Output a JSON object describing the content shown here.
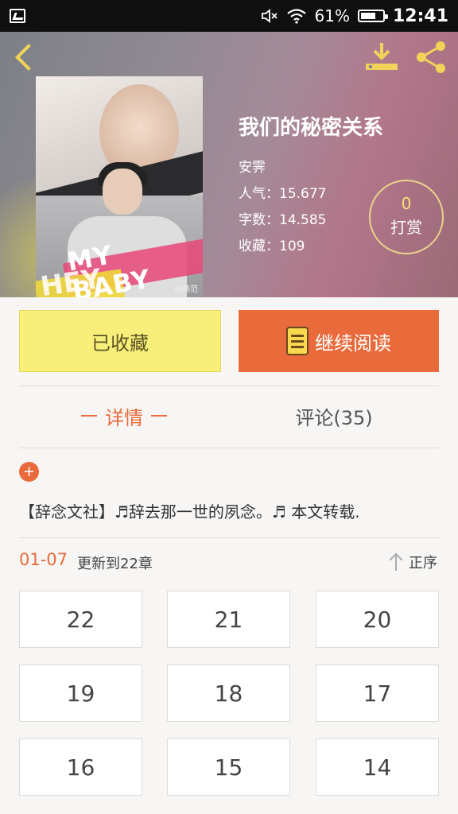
{
  "status_bar": {
    "battery": "61%",
    "time": "12:41",
    "icons": [
      "image-icon",
      "mute-icon",
      "wifi-icon",
      "battery-icon"
    ]
  },
  "book": {
    "title": "我们的秘密关系",
    "author": "安霁",
    "popularity": "人气：15.677",
    "word_count": "字数：14.585",
    "favorites": "收藏：109",
    "cover_text": {
      "line1": "MY BABY",
      "line2": "HEY",
      "watermark": "@韩范"
    }
  },
  "reward": {
    "count": "0",
    "label": "打赏"
  },
  "actions": {
    "favorited_label": "已收藏",
    "continue_label": "继续阅读"
  },
  "tabs": {
    "detail": "详情",
    "comments": "评论(35)"
  },
  "expand_icon": "+",
  "description": "【辞念文社】♬辞去那一世的夙念。♬    本文转载.",
  "update": {
    "date": "01-07",
    "text": "更新到22章",
    "sort_label": "正序"
  },
  "chapters": [
    "22",
    "21",
    "20",
    "19",
    "18",
    "17",
    "16",
    "15",
    "14"
  ]
}
